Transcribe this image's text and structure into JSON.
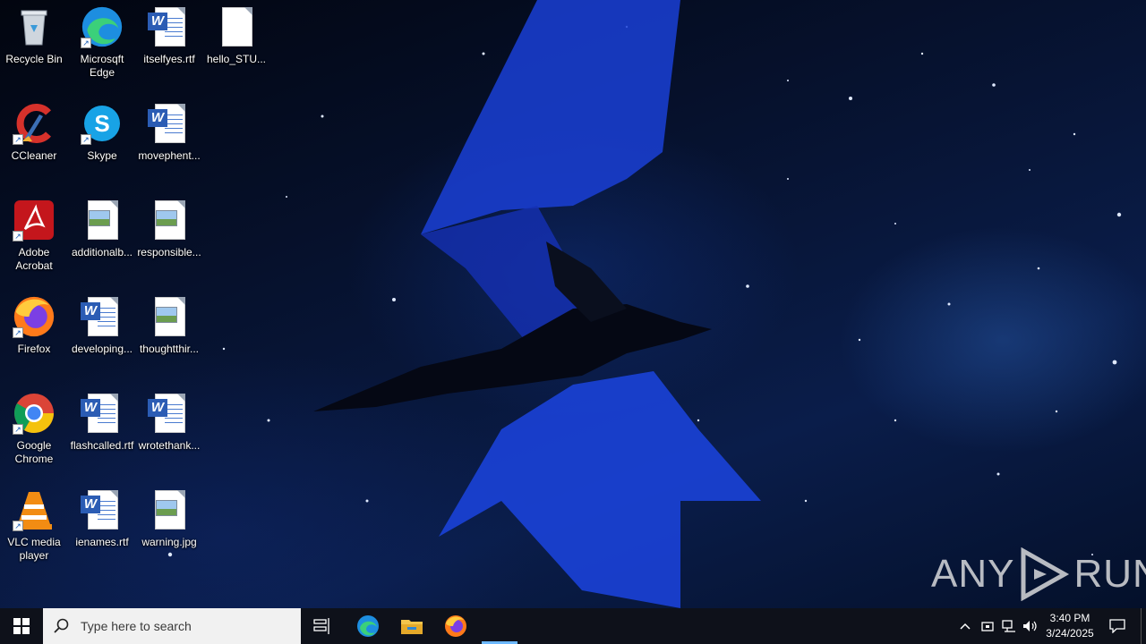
{
  "desktop": {
    "icons": [
      {
        "label": "Recycle Bin",
        "icon": "recycle-bin-icon"
      },
      {
        "label": "Microsqft Edge",
        "icon": "edge-icon"
      },
      {
        "label": "itselfyes.rtf",
        "icon": "word-document-icon"
      },
      {
        "label": "hello_STU...",
        "icon": "blank-file-icon"
      },
      {
        "label": "CCleaner",
        "icon": "ccleaner-icon"
      },
      {
        "label": "Skype",
        "icon": "skype-icon"
      },
      {
        "label": "movephent...",
        "icon": "word-document-icon"
      },
      {
        "label": "Adobe Acrobat",
        "icon": "acrobat-icon"
      },
      {
        "label": "additionalb...",
        "icon": "image-file-icon"
      },
      {
        "label": "responsible...",
        "icon": "image-file-icon"
      },
      {
        "label": "Firefox",
        "icon": "firefox-icon"
      },
      {
        "label": "developing...",
        "icon": "word-document-icon"
      },
      {
        "label": "thoughtthir...",
        "icon": "image-file-icon"
      },
      {
        "label": "Google Chrome",
        "icon": "chrome-icon"
      },
      {
        "label": "flashcalled.rtf",
        "icon": "word-document-icon"
      },
      {
        "label": "wrotethank...",
        "icon": "word-document-icon"
      },
      {
        "label": "VLC media player",
        "icon": "vlc-icon"
      },
      {
        "label": "ienames.rtf",
        "icon": "word-document-icon"
      },
      {
        "label": "warning.jpg",
        "icon": "image-file-icon"
      }
    ]
  },
  "watermark": {
    "left": "ANY",
    "right": "RUN"
  },
  "taskbar": {
    "search_placeholder": "Type here to search",
    "pinned": [
      "task-view-icon",
      "edge-icon",
      "file-explorer-icon",
      "firefox-icon"
    ],
    "clock": {
      "time": "3:40 PM",
      "date": "3/24/2025"
    }
  },
  "colors": {
    "taskbar": "#0e111a",
    "accent": "#2b5cb4",
    "active_indicator": "#6cb8ff"
  }
}
